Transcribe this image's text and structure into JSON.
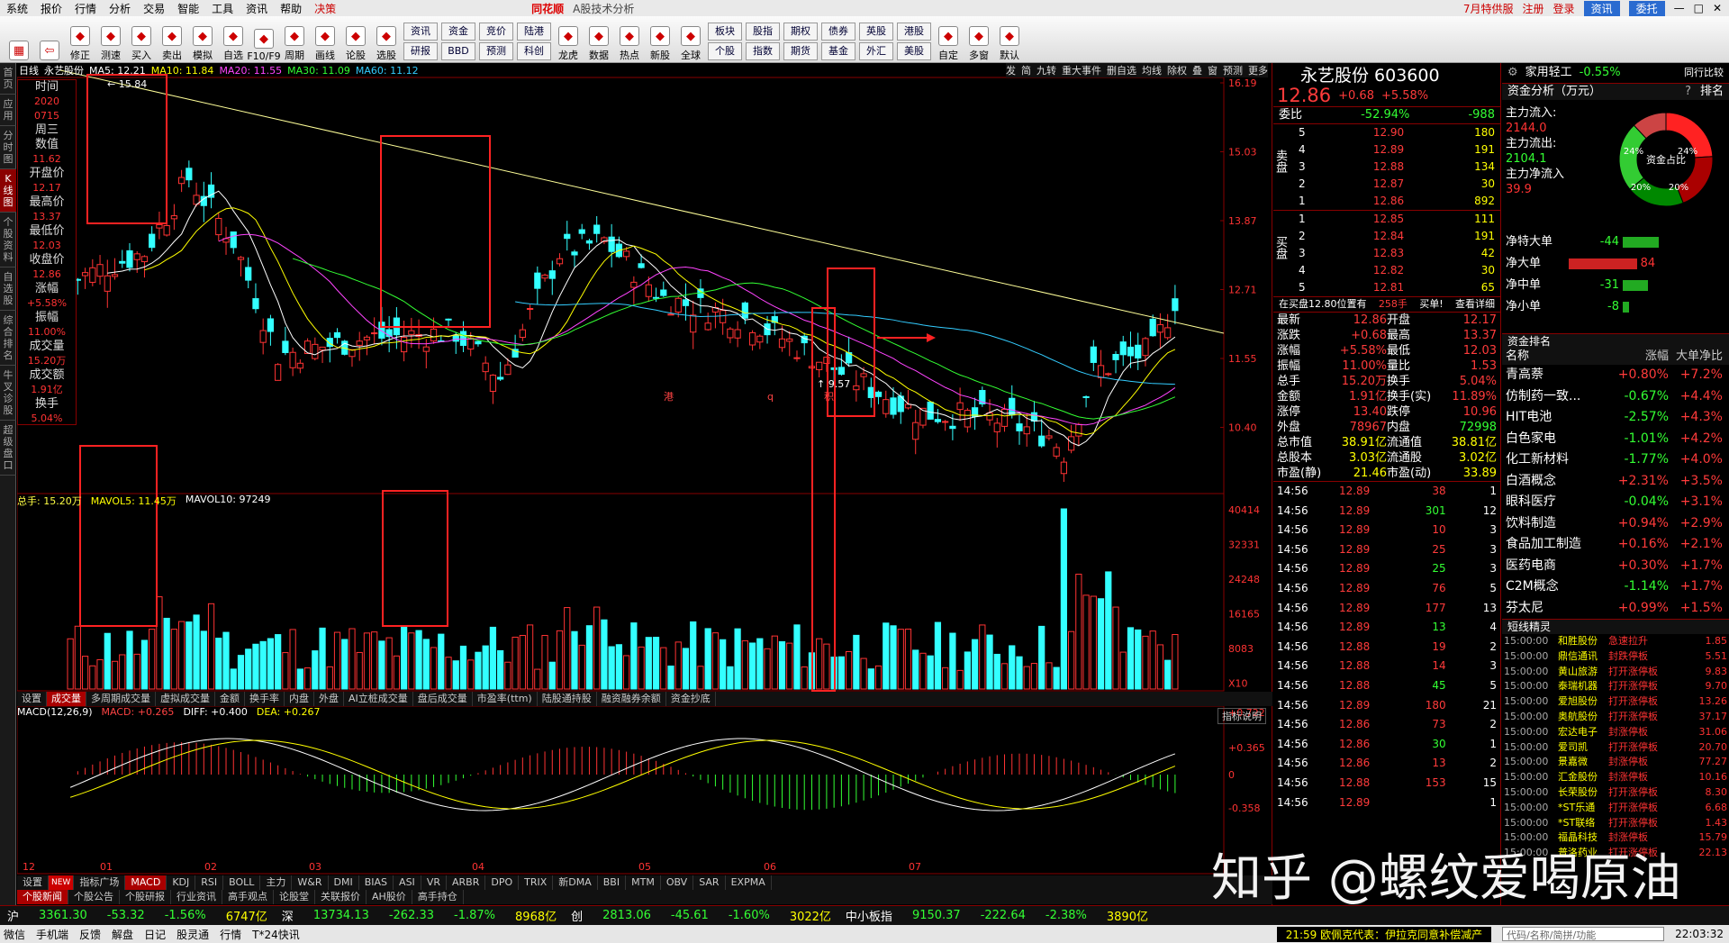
{
  "menubar": {
    "items": [
      "系统",
      "报价",
      "行情",
      "分析",
      "交易",
      "智能",
      "工具",
      "资讯",
      "帮助",
      "决策"
    ],
    "brand": "同花顺",
    "subtitle": "A股技术分析",
    "links": [
      "7月特供服",
      "注册",
      "登录"
    ],
    "btn1": "资讯",
    "btn2": "委托"
  },
  "toolbar": {
    "buttons": [
      "修正",
      "测速",
      "买入",
      "卖出",
      "模拟",
      "自选",
      "F10/F9",
      "周期",
      "画线",
      "论股",
      "选股"
    ],
    "pairs": [
      [
        "资讯",
        "研报"
      ],
      [
        "资金",
        "BBD"
      ],
      [
        "竞价",
        "预测"
      ],
      [
        "陆港",
        "科创"
      ]
    ],
    "buttons2": [
      "龙虎",
      "数据",
      "热点",
      "新股",
      "全球"
    ],
    "pairs2": [
      [
        "板块",
        "个股"
      ],
      [
        "股指",
        "指数"
      ],
      [
        "期权",
        "期货"
      ],
      [
        "债券",
        "基金"
      ],
      [
        "英股",
        "外汇"
      ],
      [
        "港股",
        "美股"
      ]
    ],
    "buttons3": [
      "自定",
      "多窗",
      "默认"
    ]
  },
  "leftnav": [
    "首页",
    "应用",
    "分时图",
    "K线图",
    "个股资料",
    "自选股",
    "综合排名",
    "牛叉诊股",
    "超级盘口"
  ],
  "chart": {
    "period": "日线",
    "name": "永艺股份",
    "ma": [
      {
        "label": "MA5: 12.21",
        "color": "#ffffff"
      },
      {
        "label": "MA10: 11.84",
        "color": "#ffff00"
      },
      {
        "label": "MA20: 11.55",
        "color": "#ff44ff"
      },
      {
        "label": "MA30: 11.09",
        "color": "#33ff33"
      },
      {
        "label": "MA60: 11.12",
        "color": "#33ccff"
      }
    ],
    "tools": [
      "发",
      "简",
      "九转",
      "重大事件",
      "删自选",
      "均线",
      "除权",
      "叠",
      "窗",
      "预测",
      "更多"
    ],
    "price_axis": [
      "16.19",
      "15.03",
      "13.87",
      "12.71",
      "11.55",
      "10.40"
    ],
    "vol_axis": [
      "40414",
      "32331",
      "24248",
      "16165",
      "8083",
      "X10"
    ],
    "macd_axis": [
      "+0.722",
      "+0.365",
      "0",
      "-0.358"
    ],
    "date_labels": [
      "12",
      "01",
      "02",
      "03",
      "04",
      "05",
      "06",
      "07"
    ],
    "high_label": "15.84",
    "low_label": "9.57",
    "markers": [
      "港",
      "q",
      "积"
    ]
  },
  "infobox": [
    [
      "时间",
      "2020"
    ],
    [
      "",
      "0715"
    ],
    [
      "周三",
      ""
    ],
    [
      "数值",
      "11.62"
    ],
    [
      "开盘价",
      "12.17"
    ],
    [
      "最高价",
      "13.37"
    ],
    [
      "最低价",
      "12.03"
    ],
    [
      "收盘价",
      "12.86"
    ],
    [
      "涨幅",
      "+5.58%"
    ],
    [
      "振幅",
      "11.00%"
    ],
    [
      "成交量",
      "15.20万"
    ],
    [
      "成交额",
      "1.91亿"
    ],
    [
      "换手",
      "5.04%"
    ]
  ],
  "volume": {
    "hand": "总手: 15.20万",
    "mavol5": "MAVOL5: 11.45万",
    "mavol10": "MAVOL10: 97249"
  },
  "indicator_tabs": [
    "设置",
    "成交量",
    "多周期成交量",
    "虚拟成交量",
    "金额",
    "换手率",
    "内盘",
    "外盘",
    "AI立桩成交量",
    "盘后成交量",
    "市盈率(ttm)",
    "陆股通持股",
    "融资融券余额",
    "资金抄底"
  ],
  "macd": {
    "title": "MACD(12,26,9)",
    "macd": "MACD: +0.265",
    "diff": "DIFF: +0.400",
    "dea": "DEA: +0.267",
    "explain": "指标说明"
  },
  "bottom_tabs": [
    "设置",
    "NEW",
    "指标广场",
    "MACD",
    "KDJ",
    "RSI",
    "BOLL",
    "主力",
    "W&R",
    "DMI",
    "BIAS",
    "ASI",
    "VR",
    "ARBR",
    "DPO",
    "TRIX",
    "新DMA",
    "BBI",
    "MTM",
    "OBV",
    "SAR",
    "EXPMA"
  ],
  "bottom_tabs2": [
    "个股新闻",
    "个股公告",
    "个股研报",
    "行业资讯",
    "高手观点",
    "论股堂",
    "关联报价",
    "AH股价",
    "高手持仓"
  ],
  "quote": {
    "title": "永艺股份 603600",
    "price": "12.86",
    "change": "+0.68",
    "pct": "+5.58%",
    "weibi_label": "委比",
    "weibi": "-52.94%",
    "weicha": "-988",
    "sell": [
      [
        "5",
        "12.90",
        "180"
      ],
      [
        "4",
        "12.89",
        "191"
      ],
      [
        "3",
        "12.88",
        "134"
      ],
      [
        "2",
        "12.87",
        "30"
      ],
      [
        "1",
        "12.86",
        "892"
      ]
    ],
    "buy": [
      [
        "1",
        "12.85",
        "111"
      ],
      [
        "2",
        "12.84",
        "191"
      ],
      [
        "3",
        "12.83",
        "42"
      ],
      [
        "4",
        "12.82",
        "30"
      ],
      [
        "5",
        "12.81",
        "65"
      ]
    ],
    "sell_label": "卖盘",
    "buy_label": "买盘",
    "tape_label": "在买盘12.80位置有",
    "tape_qty": "258手",
    "tape_act": "买单!",
    "tape_more": "查看详细",
    "stats": [
      [
        "最新",
        "12.86",
        "开盘",
        "12.17"
      ],
      [
        "涨跌",
        "+0.68",
        "最高",
        "13.37"
      ],
      [
        "涨幅",
        "+5.58%",
        "最低",
        "12.03"
      ],
      [
        "振幅",
        "11.00%",
        "量比",
        "1.53"
      ],
      [
        "总手",
        "15.20万",
        "换手",
        "5.04%"
      ],
      [
        "金额",
        "1.91亿",
        "换手(实)",
        "11.89%"
      ],
      [
        "涨停",
        "13.40",
        "跌停",
        "10.96"
      ],
      [
        "外盘",
        "78967",
        "内盘",
        "72998"
      ],
      [
        "总市值",
        "38.91亿",
        "流通值",
        "38.81亿"
      ],
      [
        "总股本",
        "3.03亿",
        "流通股",
        "3.02亿"
      ],
      [
        "市盈(静)",
        "21.46",
        "市盈(动)",
        "33.89"
      ]
    ],
    "ticks": [
      [
        "14:56",
        "12.89",
        "38",
        "1"
      ],
      [
        "14:56",
        "12.89",
        "301",
        "12"
      ],
      [
        "14:56",
        "12.89",
        "10",
        "3"
      ],
      [
        "14:56",
        "12.89",
        "25",
        "3"
      ],
      [
        "14:56",
        "12.89",
        "25",
        "3"
      ],
      [
        "14:56",
        "12.89",
        "76",
        "5"
      ],
      [
        "14:56",
        "12.89",
        "177",
        "13"
      ],
      [
        "14:56",
        "12.89",
        "13",
        "4"
      ],
      [
        "14:56",
        "12.88",
        "19",
        "2"
      ],
      [
        "14:56",
        "12.88",
        "14",
        "3"
      ],
      [
        "14:56",
        "12.88",
        "45",
        "5"
      ],
      [
        "14:56",
        "12.89",
        "180",
        "21"
      ],
      [
        "14:56",
        "12.86",
        "73",
        "2"
      ],
      [
        "14:56",
        "12.86",
        "30",
        "1"
      ],
      [
        "14:56",
        "12.86",
        "13",
        "2"
      ],
      [
        "14:56",
        "12.88",
        "153",
        "15"
      ],
      [
        "14:56",
        "12.89",
        "",
        "1"
      ]
    ]
  },
  "right": {
    "industry": "家用轻工",
    "industry_pct": "-0.55%",
    "peer": "同行比较",
    "flow_title": "资金分析（万元）",
    "flow_help": "?",
    "flow_rank": "排名",
    "flows": [
      [
        "主力流入:",
        "2144.0"
      ],
      [
        "主力流出:",
        "2104.1"
      ],
      [
        "主力净流入",
        "39.9"
      ]
    ],
    "donut_center": "资金占比",
    "donut": [
      {
        "pct": 24,
        "color": "#ff2222"
      },
      {
        "pct": 20,
        "color": "#aa0000"
      },
      {
        "pct": 20,
        "color": "#008800"
      },
      {
        "pct": 24,
        "color": "#33cc33"
      },
      {
        "pct": 12,
        "color": "#cc4444"
      }
    ],
    "donut_labels": [
      "24%",
      "24%",
      "20%",
      "20%"
    ],
    "net": [
      [
        "净特大单",
        "-44",
        "#22aa22"
      ],
      [
        "净大单",
        "84",
        "#cc2222"
      ],
      [
        "净中单",
        "-31",
        "#22aa22"
      ],
      [
        "净小单",
        "-8",
        "#22aa22"
      ]
    ],
    "rank_title": "资金排名",
    "rank_head": [
      "名称",
      "涨幅",
      "大单净比"
    ],
    "ranks": [
      [
        "青高萘",
        "+0.80%",
        "+7.2%"
      ],
      [
        "仿制药一致...",
        "-0.67%",
        "+4.4%"
      ],
      [
        "HIT电池",
        "-2.57%",
        "+4.3%"
      ],
      [
        "白色家电",
        "-1.01%",
        "+4.2%"
      ],
      [
        "化工新材料",
        "-1.77%",
        "+4.0%"
      ],
      [
        "白酒概念",
        "+2.31%",
        "+3.5%"
      ],
      [
        "眼科医疗",
        "-0.04%",
        "+3.1%"
      ],
      [
        "饮料制造",
        "+0.94%",
        "+2.9%"
      ],
      [
        "食品加工制造",
        "+0.16%",
        "+2.1%"
      ],
      [
        "医药电商",
        "+0.30%",
        "+1.7%"
      ],
      [
        "C2M概念",
        "-1.14%",
        "+1.7%"
      ],
      [
        "芬太尼",
        "+0.99%",
        "+1.5%"
      ]
    ],
    "alert_title": "短线精灵",
    "alerts": [
      [
        "15:00:00",
        "和胜股份",
        "急速拉升",
        "1.85"
      ],
      [
        "15:00:00",
        "鼎信通讯",
        "封跌停板",
        "5.51"
      ],
      [
        "15:00:00",
        "黄山旅游",
        "打开涨停板",
        "9.83"
      ],
      [
        "15:00:00",
        "泰瑞机器",
        "打开涨停板",
        "9.70"
      ],
      [
        "15:00:00",
        "爱旭股份",
        "打开涨停板",
        "13.26"
      ],
      [
        "15:00:00",
        "奥航股份",
        "打开涨停板",
        "37.17"
      ],
      [
        "15:00:00",
        "宏达电子",
        "封涨停板",
        "31.06"
      ],
      [
        "15:00:00",
        "爱司凯",
        "打开涨停板",
        "20.70"
      ],
      [
        "15:00:00",
        "景嘉微",
        "封涨停板",
        "77.27"
      ],
      [
        "15:00:00",
        "汇金股份",
        "封涨停板",
        "10.16"
      ],
      [
        "15:00:00",
        "长荣股份",
        "打开涨停板",
        "8.30"
      ],
      [
        "15:00:00",
        "*ST乐通",
        "打开涨停板",
        "6.68"
      ],
      [
        "15:00:00",
        "*ST联络",
        "打开涨停板",
        "1.43"
      ],
      [
        "15:00:00",
        "福晶科技",
        "封涨停板",
        "15.79"
      ],
      [
        "15:00:00",
        "普洛药业",
        "打开涨停板",
        "22.13"
      ]
    ]
  },
  "statusbar": [
    {
      "name": "沪",
      "val": "3361.30",
      "chg": "-53.32",
      "pct": "-1.56%",
      "amt": "6747亿"
    },
    {
      "name": "深",
      "val": "13734.13",
      "chg": "-262.33",
      "pct": "-1.87%",
      "amt": "8968亿"
    },
    {
      "name": "创",
      "val": "2813.06",
      "chg": "-45.61",
      "pct": "-1.60%",
      "amt": "3022亿"
    },
    {
      "name": "中小板指",
      "val": "9150.37",
      "chg": "-222.64",
      "pct": "-2.38%",
      "amt": "3890亿"
    }
  ],
  "taskbar": {
    "items": [
      "微信",
      "手机端",
      "反馈",
      "解盘",
      "日记",
      "股灵通",
      "行情",
      "T*24快讯"
    ],
    "marquee": "21:59 欧佩克代表：伊拉克同意补偿减产",
    "search": "代码/名称/简拼/功能",
    "clock": "22:03:32"
  },
  "watermark": "知乎 @螺纹爱喝原油",
  "chart_data": {
    "type": "candlestick",
    "title": "永艺股份 603600 日线",
    "price_range": [
      9.57,
      16.19
    ],
    "last": {
      "open": 12.17,
      "high": 13.37,
      "low": 12.03,
      "close": 12.86
    }
  }
}
